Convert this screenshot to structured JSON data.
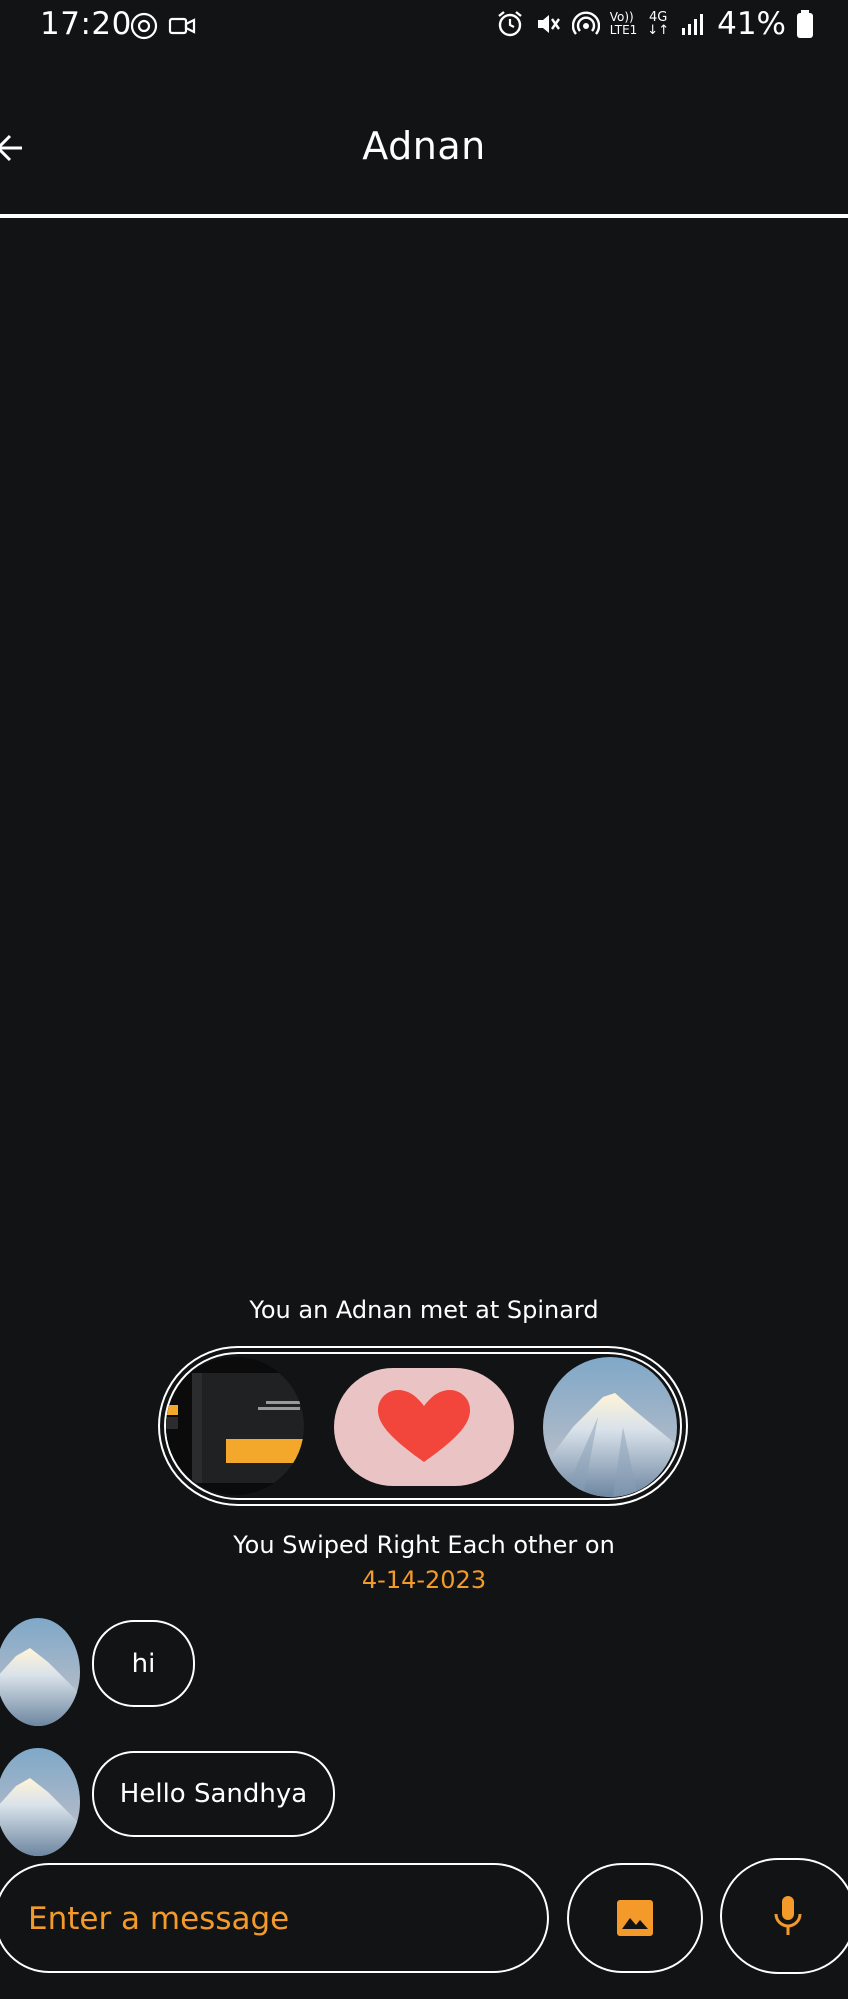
{
  "status_bar": {
    "time": "17:20",
    "battery": "41%",
    "network_label_top": "Vo))",
    "network_label_bottom": "LTE1",
    "network_type": "4G"
  },
  "header": {
    "title": "Adnan",
    "back_icon": "back-arrow-icon"
  },
  "match": {
    "meet_text": "You an Adnan met at Spinard",
    "swipe_text": "You Swiped Right Each other on",
    "date": "4-14-2023",
    "heart_icon": "heart-icon"
  },
  "messages": [
    {
      "text": "hi"
    },
    {
      "text": "Hello Sandhya"
    }
  ],
  "composer": {
    "placeholder": "Enter a message",
    "gallery_icon": "image-icon",
    "mic_icon": "microphone-icon"
  },
  "colors": {
    "background": "#111315",
    "accent": "#f39a2b",
    "heart": "#f2453b",
    "heart_bg": "#eac4c4"
  }
}
